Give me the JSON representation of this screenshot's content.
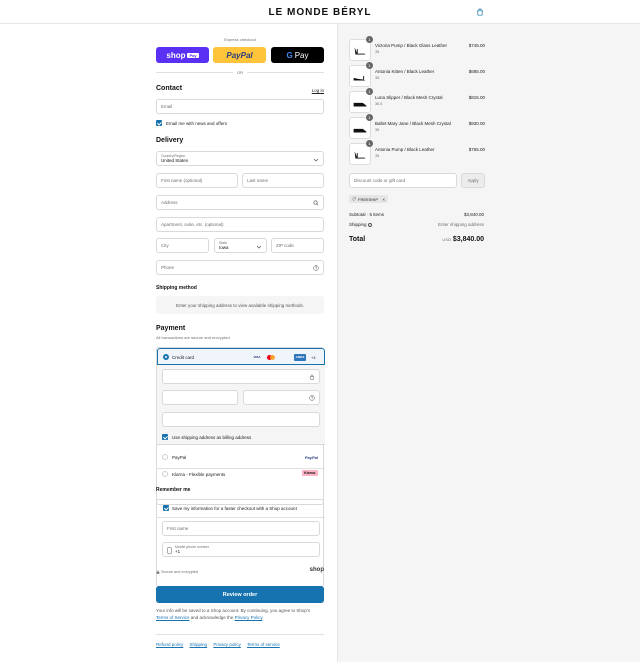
{
  "header": {
    "brand": "LE MONDE BÉRYL",
    "cart_icon": "shopping-bag-icon"
  },
  "express": {
    "label": "Express checkout",
    "shop_pay": "shop",
    "shop_pay_badge": "Pay",
    "paypal": "PayPal",
    "gpay_g": "G",
    "gpay": "Pay",
    "or": "OR"
  },
  "contact": {
    "title": "Contact",
    "login": "Log in",
    "email_placeholder": "Email",
    "email_news": "Email me with news and offers"
  },
  "delivery": {
    "title": "Delivery",
    "country_label": "Country/Region",
    "country_value": "United States",
    "first_name": "First name (optional)",
    "last_name": "Last name",
    "address": "Address",
    "apartment": "Apartment, suite, etc. (optional)",
    "city": "City",
    "state_label": "State",
    "state_value": "Iowa",
    "zip": "ZIP code",
    "phone": "Phone"
  },
  "shipping_method": {
    "title": "Shipping method",
    "note": "Enter your shipping address to view available shipping methods."
  },
  "payment": {
    "title": "Payment",
    "subtitle": "All transactions are secure and encrypted.",
    "credit_card": "Credit card",
    "cards": [
      "VISA",
      "",
      "AMEX",
      "+4"
    ],
    "billing_same": "Use shipping address as billing address",
    "paypal": "PayPal",
    "paypal_logo": "PayPal",
    "klarna": "Klarna - Flexible payments",
    "klarna_logo": "Klarna."
  },
  "remember": {
    "title": "Remember me",
    "save_info": "Save my information for a faster checkout with a Shop account",
    "first_name": "First name",
    "mobile_label": "Mobile phone number",
    "mobile_value": "+1",
    "secure": "Secure and encrypted",
    "shop_logo": "shop"
  },
  "review": {
    "button": "Review order",
    "note_pre": "Your info will be saved to a Shop account. By continuing, you agree to Shop's",
    "terms": "Terms of Service",
    "note_mid": "and acknowledge the",
    "privacy": "Privacy Policy",
    "note_end": "."
  },
  "footer": {
    "links": [
      "Refund policy",
      "Shipping",
      "Privacy policy",
      "Terms of service"
    ]
  },
  "cart": {
    "items": [
      {
        "qty": "1",
        "name": "Victoria Pump / Black Glass Leather",
        "variant": "35",
        "price": "$745.00"
      },
      {
        "qty": "1",
        "name": "Antonia Kitten / Black Leather",
        "variant": "35",
        "price": "$685.00"
      },
      {
        "qty": "1",
        "name": "Luna Slipper / Black Mesh Crystal",
        "variant": "36.5",
        "price": "$815.00"
      },
      {
        "qty": "1",
        "name": "Ballet Mary Jane / Black Mesh Crystal",
        "variant": "35",
        "price": "$830.00"
      },
      {
        "qty": "1",
        "name": "Antonia Pump / Black Leather",
        "variant": "35",
        "price": "$765.00"
      }
    ],
    "discount_placeholder": "Discount code or gift card",
    "apply": "Apply",
    "code": "FREESHIP",
    "subtotal_label": "Subtotal · 5 items",
    "subtotal_value": "$3,840.00",
    "shipping_label": "Shipping",
    "shipping_value": "Enter shipping address",
    "total_label": "Total",
    "currency": "USD",
    "total_value": "$3,840.00"
  }
}
